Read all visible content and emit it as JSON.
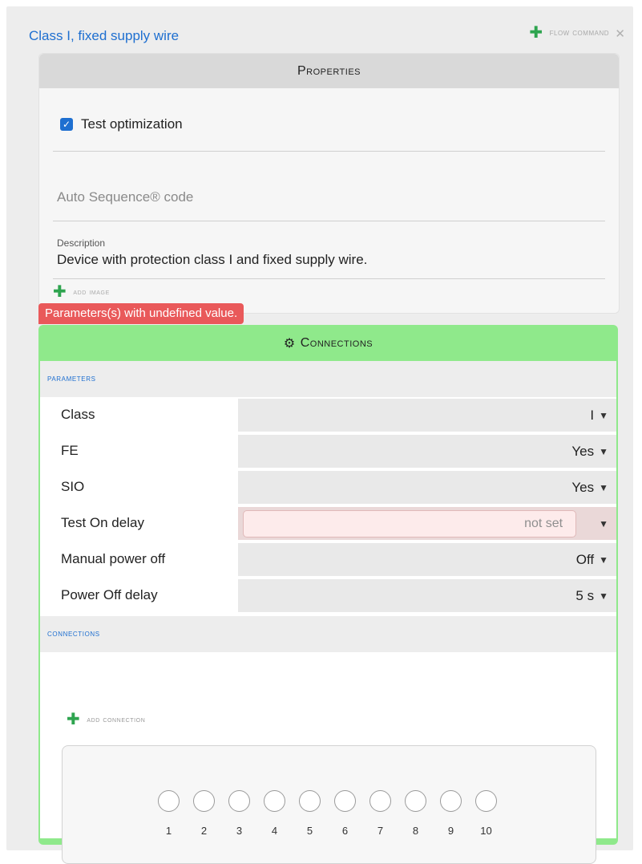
{
  "header": {
    "title": "Class I, fixed supply wire",
    "flow_command_label": "flow command",
    "close_glyph": "✕"
  },
  "properties": {
    "title": "Properties",
    "test_optimization_label": "Test optimization",
    "test_optimization_checked": true,
    "auto_sequence_placeholder": "Auto Sequence® code",
    "description_label": "Description",
    "description_value": "Device with protection class I and fixed supply wire.",
    "add_image_label": "add image"
  },
  "warning": "Parameters(s) with undefined value.",
  "connections_card": {
    "title": "Connections",
    "gear_glyph": "⚙",
    "parameters_heading": "parameters",
    "parameters": [
      {
        "name": "Class",
        "value": "I"
      },
      {
        "name": "FE",
        "value": "Yes"
      },
      {
        "name": "SIO",
        "value": "Yes"
      },
      {
        "name": "Test On delay",
        "value": "not set",
        "error": true
      },
      {
        "name": "Manual power off",
        "value": "Off"
      },
      {
        "name": "Power Off delay",
        "value": "5 s"
      }
    ],
    "connections_heading": "connections",
    "add_connection_label": "add connection",
    "ports": [
      "1",
      "2",
      "3",
      "4",
      "5",
      "6",
      "7",
      "8",
      "9",
      "10"
    ]
  },
  "colors": {
    "accent": "#1e6fd0",
    "ok_green": "#8fe98b",
    "error_red": "#e9595a",
    "plus_green": "#2ea44f"
  },
  "icons": {
    "dropdown": "▼",
    "plus": "✚",
    "check": "✓"
  }
}
